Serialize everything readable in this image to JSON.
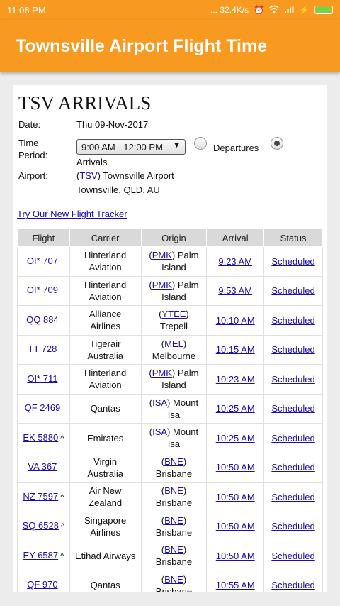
{
  "status_bar": {
    "time": "11:06 PM",
    "net_speed": "... 32.4K/s"
  },
  "app_bar": {
    "title": "Townsville Airport Flight Time"
  },
  "page": {
    "title": "TSV ARRIVALS",
    "date_label": "Date:",
    "date_value": "Thu 09-Nov-2017",
    "time_label_1": "Time",
    "time_label_2": "Period:",
    "time_period": "9:00 AM - 12:00 PM",
    "departures_label": "Departures",
    "arrivals_label": "Arrivals",
    "airport_label": "Airport:",
    "airport_code": "TSV",
    "airport_name": "Townsville Airport",
    "airport_city": "Townsville, QLD, AU",
    "tracker_link": "Try Our New Flight Tracker"
  },
  "table": {
    "headers": [
      "Flight",
      "Carrier",
      "Origin",
      "Arrival",
      "Status"
    ],
    "rows": [
      {
        "flight": "OI* 707",
        "caret": "",
        "carrier1": "Hinterland",
        "carrier2": "Aviation",
        "origin_code": "PMK",
        "origin1": " Palm",
        "origin2": "Island",
        "arrival": "9:23 AM",
        "status": "Scheduled"
      },
      {
        "flight": "OI* 709",
        "caret": "",
        "carrier1": "Hinterland",
        "carrier2": "Aviation",
        "origin_code": "PMK",
        "origin1": " Palm",
        "origin2": "Island",
        "arrival": "9:53 AM",
        "status": "Scheduled"
      },
      {
        "flight": "QQ 884",
        "caret": "",
        "carrier1": "Alliance",
        "carrier2": "Airlines",
        "origin_code": "YTEE",
        "origin1": "",
        "origin2": "Trepell",
        "arrival": "10:10 AM",
        "status": "Scheduled"
      },
      {
        "flight": "TT 728",
        "caret": "",
        "carrier1": "Tigerair",
        "carrier2": "Australia",
        "origin_code": "MEL",
        "origin1": "",
        "origin2": "Melbourne",
        "arrival": "10:15 AM",
        "status": "Scheduled"
      },
      {
        "flight": "OI* 711",
        "caret": "",
        "carrier1": "Hinterland",
        "carrier2": "Aviation",
        "origin_code": "PMK",
        "origin1": " Palm",
        "origin2": "Island",
        "arrival": "10:23 AM",
        "status": "Scheduled"
      },
      {
        "flight": "QF 2469",
        "caret": "",
        "carrier1": "Qantas",
        "carrier2": "",
        "origin_code": "ISA",
        "origin1": " Mount",
        "origin2": "Isa",
        "arrival": "10:25 AM",
        "status": "Scheduled"
      },
      {
        "flight": "EK 5880",
        "caret": "^",
        "carrier1": "Emirates",
        "carrier2": "",
        "origin_code": "ISA",
        "origin1": " Mount",
        "origin2": "Isa",
        "arrival": "10:25 AM",
        "status": "Scheduled"
      },
      {
        "flight": "VA 367",
        "caret": "",
        "carrier1": "Virgin",
        "carrier2": "Australia",
        "origin_code": "BNE",
        "origin1": "",
        "origin2": "Brisbane",
        "arrival": "10:50 AM",
        "status": "Scheduled"
      },
      {
        "flight": "NZ 7597",
        "caret": "^",
        "carrier1": "Air New",
        "carrier2": "Zealand",
        "origin_code": "BNE",
        "origin1": "",
        "origin2": "Brisbane",
        "arrival": "10:50 AM",
        "status": "Scheduled"
      },
      {
        "flight": "SQ 6528",
        "caret": "^",
        "carrier1": "Singapore",
        "carrier2": "Airlines",
        "origin_code": "BNE",
        "origin1": "",
        "origin2": "Brisbane",
        "arrival": "10:50 AM",
        "status": "Scheduled"
      },
      {
        "flight": "EY 6587",
        "caret": "^",
        "carrier1": "Etihad Airways",
        "carrier2": "",
        "origin_code": "BNE",
        "origin1": "",
        "origin2": "Brisbane",
        "arrival": "10:50 AM",
        "status": "Scheduled"
      },
      {
        "flight": "QF 970",
        "caret": "",
        "carrier1": "Qantas",
        "carrier2": "",
        "origin_code": "BNE",
        "origin1": "",
        "origin2": "Brisbane",
        "arrival": "10:55 AM",
        "status": "Scheduled"
      }
    ]
  }
}
